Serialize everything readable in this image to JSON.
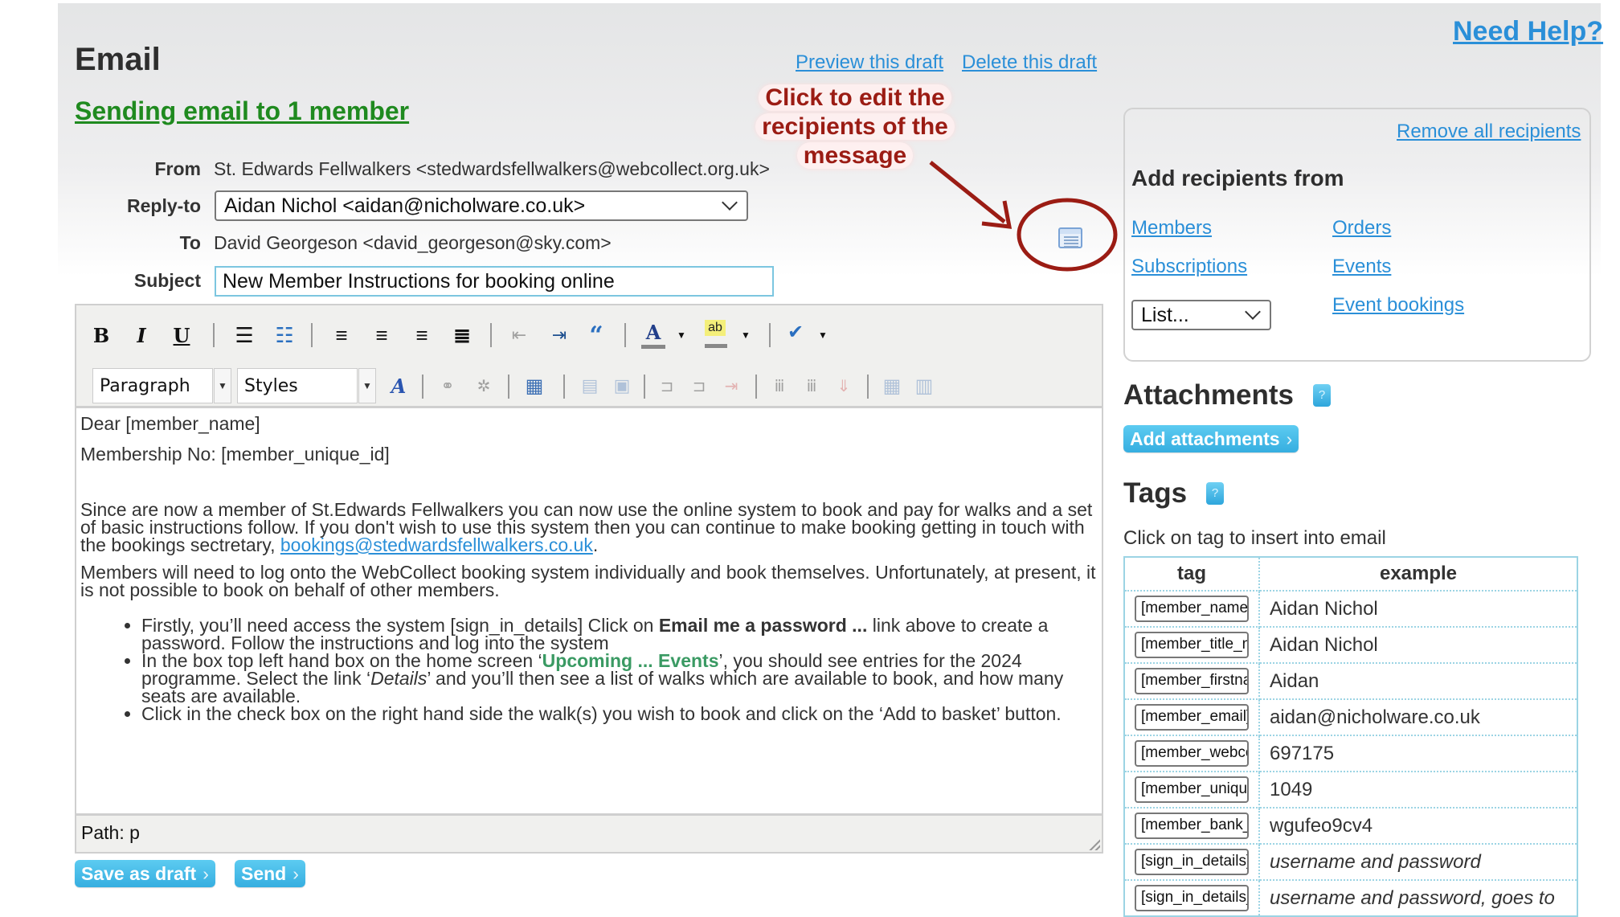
{
  "header": {
    "title": "Email",
    "sending": "Sending email to 1 member",
    "need_help": "Need Help?",
    "preview_link": "Preview this draft",
    "delete_link": "Delete this draft"
  },
  "annotation": {
    "callout": "Click to edit the recipients of the message",
    "callout_lines": [
      "Click to edit the",
      "recipients of the",
      "message"
    ],
    "color": "#9b1c14"
  },
  "fields": {
    "from_label": "From",
    "from_value": "St. Edwards Fellwalkers <stedwardsfellwalkers@webcollect.org.uk>",
    "reply_to_label": "Reply-to",
    "reply_to_value": "Aidan Nichol <aidan@nicholware.co.uk>",
    "to_label": "To",
    "to_value": "David Georgeson <david_georgeson@sky.com>",
    "subject_label": "Subject",
    "subject_value": "New Member Instructions for booking online"
  },
  "editor": {
    "toolbar_row1": [
      "bold",
      "italic",
      "underline",
      "bullet-list",
      "numbered-list",
      "align-left",
      "align-center",
      "align-right",
      "align-justify",
      "outdent",
      "indent",
      "blockquote",
      "text-color",
      "highlight-color",
      "spellcheck"
    ],
    "format_select": "Paragraph",
    "styles_select": "Styles",
    "toolbar_row2": [
      "font-style",
      "link",
      "unlink",
      "insert-table-edit",
      "row-props",
      "cell-props",
      "insert-row-before",
      "insert-row-after",
      "delete-row",
      "insert-col-before",
      "insert-col-after",
      "delete-col",
      "table",
      "merge-cells"
    ],
    "content": {
      "greeting": "Dear [member_name]",
      "membership": "Membership No: [member_unique_id]",
      "para1_a": "Since are now a member of St.Edwards Fellwalkers you can now use the online system to book and pay for walks and a set of basic instructions follow. If you don't wish to use this system then you can continue to make booking getting in touch with the bookings sectretary, ",
      "para1_link": "bookings@stedwardsfellwalkers.co.uk",
      "para1_end": ".",
      "para2": "Members will need to log onto the WebCollect booking system individually and book themselves.  Unfortunately, at present, it is not possible to book on behalf of other members.",
      "bullet1_a": "Firstly, you’ll need access the system [sign_in_details] Click on ",
      "bullet1_bold": "Email me a password ...",
      "bullet1_b": "  link above to create a password. Follow the instructions and log into the system",
      "bullet2_a": "In the box top left hand box on the home screen ‘",
      "bullet2_green": "Upcoming ... Events",
      "bullet2_b": "’, you should see entries for the  2024 programme. Select the link ‘",
      "bullet2_ital": "Details",
      "bullet2_c": "’ and you’ll then see a list of walks which are available to book, and how many seats are available.",
      "bullet3": "Click in the check box on the right hand side the walk(s) you wish to book and click on the ‘Add to basket’ button."
    },
    "path": "Path: p"
  },
  "buttons": {
    "save_draft": "Save as draft",
    "send": "Send",
    "add_attachments": "Add attachments",
    "arrow": "›"
  },
  "recipients_panel": {
    "remove_all": "Remove all recipients",
    "heading": "Add recipients from",
    "links": [
      "Members",
      "Subscriptions",
      "Orders",
      "Events",
      "Event bookings"
    ],
    "list_select": "List..."
  },
  "attachments": {
    "heading": "Attachments",
    "help": "?"
  },
  "tags": {
    "heading": "Tags",
    "help": "?",
    "note": "Click on tag to insert into email",
    "columns": [
      "tag",
      "example"
    ],
    "rows": [
      {
        "tag": "[member_name]",
        "example": "Aidan Nichol",
        "italic": false
      },
      {
        "tag": "[member_title_name]",
        "example": "Aidan Nichol",
        "italic": false
      },
      {
        "tag": "[member_firstname]",
        "example": "Aidan",
        "italic": false
      },
      {
        "tag": "[member_email]",
        "example": "aidan@nicholware.co.uk",
        "italic": false
      },
      {
        "tag": "[member_webcollect_id]",
        "example": "697175",
        "italic": false
      },
      {
        "tag": "[member_unique_id]",
        "example": "1049",
        "italic": false
      },
      {
        "tag": "[member_bank_ref]",
        "example": "wgufeo9cv4",
        "italic": false
      },
      {
        "tag": "[sign_in_details]",
        "example": "username and password",
        "italic": true
      },
      {
        "tag": "[sign_in_details_link]",
        "example": "username and password, goes to",
        "italic": true
      }
    ]
  },
  "colors": {
    "link": "#2a8fd8",
    "green_heading": "#1f8a1f",
    "button_blue": "#36aee0",
    "annotation_red": "#9b1c14",
    "table_border": "#9cd4e4"
  }
}
